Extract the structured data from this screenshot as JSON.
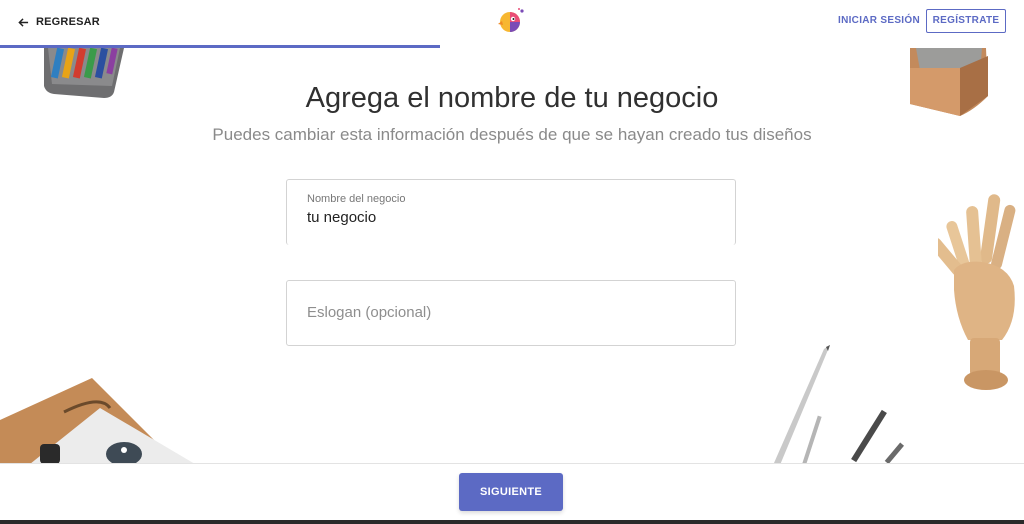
{
  "header": {
    "back_label": "REGRESAR",
    "login_label": "INICIAR SESIÓN",
    "signup_label": "REGÍSTRATE",
    "logo_icon": "parrot-logo-icon",
    "progress_percent": 43
  },
  "main": {
    "title": "Agrega el nombre de tu negocio",
    "subtitle": "Puedes cambiar esta información después de que se hayan creado tus diseños",
    "business_name": {
      "label": "Nombre del negocio",
      "value": "tu negocio"
    },
    "slogan": {
      "placeholder": "Eslogan (opcional)",
      "value": ""
    }
  },
  "footer": {
    "next_label": "SIGUIENTE"
  },
  "colors": {
    "accent": "#5c6ac4",
    "text": "#303030",
    "muted": "#8a8a8a"
  }
}
